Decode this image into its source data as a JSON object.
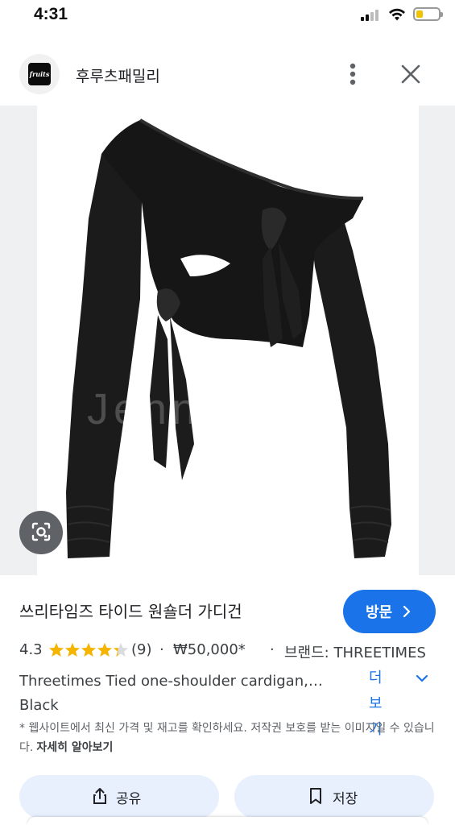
{
  "status_bar": {
    "time": "4:31",
    "battery_level": 0.3,
    "battery_color": "#f2c200"
  },
  "header": {
    "site_name": "후루츠패밀리",
    "logo_text": "fruits",
    "more_icon": "more-vert-icon",
    "close_icon": "close-icon"
  },
  "image": {
    "alt": "Threetimes Tied one-shoulder cardigan, Black",
    "watermark": "Jennylara"
  },
  "product": {
    "title": "쓰리타임즈 타이드 원숄더 가디건",
    "visit_label": "방문",
    "rating": "4.3",
    "rating_value": 4.3,
    "review_count": "(9)",
    "separator": "·",
    "price": "₩50,000*",
    "brand": "브랜드: THREETIMES",
    "description": "Threetimes Tied one-shoulder cardigan,… Black",
    "more_label": "더보기",
    "disclaimer": "* 웹사이트에서 최신 가격 및 재고를 확인하세요. 저작권 보호를 받는 이미지일 수 있습니다.",
    "learn_more": "자세히 알아보기"
  },
  "actions": {
    "share_label": "공유",
    "save_label": "저장"
  },
  "colors": {
    "accent": "#1a73e8",
    "star": "#f4b400",
    "button_bg": "#e8f0fe"
  }
}
